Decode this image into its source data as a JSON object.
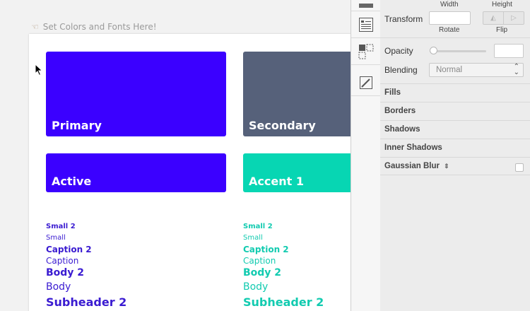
{
  "canvas": {
    "artboard_title": "Set Colors and Fonts Here!",
    "swatches": [
      {
        "label": "Primary",
        "color": "#3b00ff"
      },
      {
        "label": "Secondary",
        "color": "#56617a"
      },
      {
        "label": "Active",
        "color": "#3b00ff"
      },
      {
        "label": "Accent 1",
        "color": "#07d6b3"
      }
    ],
    "type_left": {
      "color": "#3a1bd1",
      "items": [
        "Small 2",
        "Small",
        "Caption 2",
        "Caption",
        "Body 2",
        "Body",
        "Subheader 2"
      ]
    },
    "type_right": {
      "color": "#12cbb0",
      "items": [
        "Small 2",
        "Small",
        "Caption 2",
        "Caption",
        "Body 2",
        "Body",
        "Subheader 2"
      ]
    }
  },
  "inspector": {
    "width_label": "Width",
    "height_label": "Height",
    "transform_label": "Transform",
    "rotate_label": "Rotate",
    "flip_label": "Flip",
    "opacity_label": "Opacity",
    "opacity_value": "",
    "opacity_level": 0,
    "blending_label": "Blending",
    "blending_value": "Normal",
    "sections": {
      "fills": "Fills",
      "borders": "Borders",
      "shadows": "Shadows",
      "inner_shadows": "Inner Shadows",
      "gaussian_blur": "Gaussian Blur"
    }
  },
  "colors": {
    "accent": "#3b00ff",
    "teal": "#07d6b3"
  }
}
